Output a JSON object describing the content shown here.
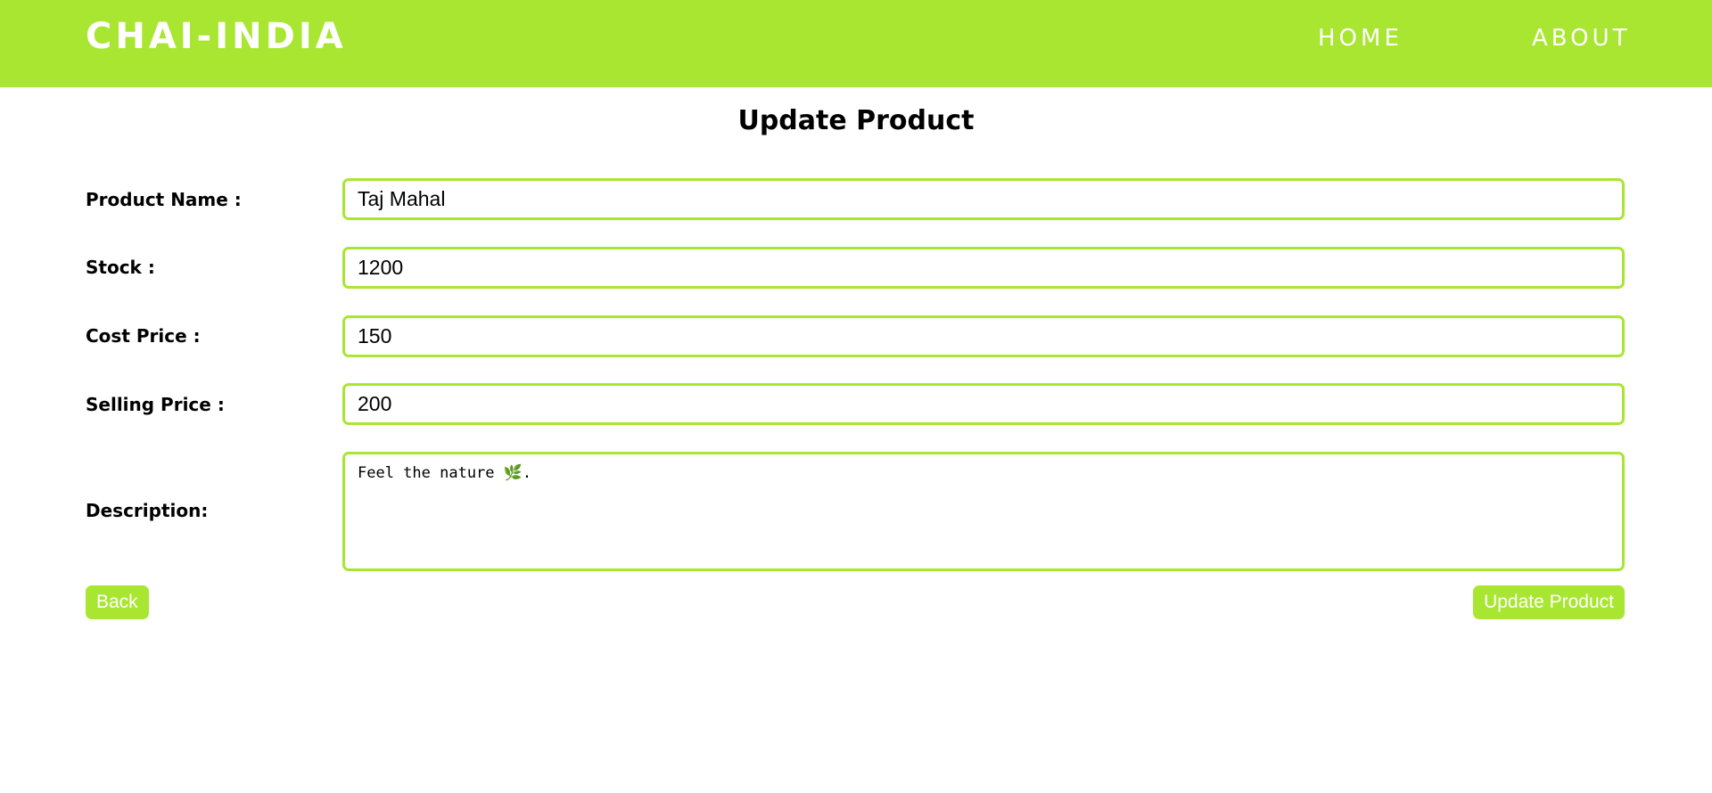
{
  "navbar": {
    "brand": "CHAI-INDIA",
    "links": [
      "HOME",
      "ABOUT"
    ]
  },
  "page": {
    "title": "Update Product"
  },
  "form": {
    "product_name": {
      "label": "Product Name :",
      "value": "Taj Mahal"
    },
    "stock": {
      "label": "Stock :",
      "value": "1200"
    },
    "cost_price": {
      "label": "Cost Price :",
      "value": "150"
    },
    "selling_price": {
      "label": "Selling Price :",
      "value": "200"
    },
    "description": {
      "label": "Description:",
      "value": "Feel the nature 🌿."
    }
  },
  "buttons": {
    "back": "Back",
    "update": "Update Product"
  },
  "colors": {
    "accent": "#a9e631",
    "background": "#ffffff",
    "text": "#000000"
  }
}
